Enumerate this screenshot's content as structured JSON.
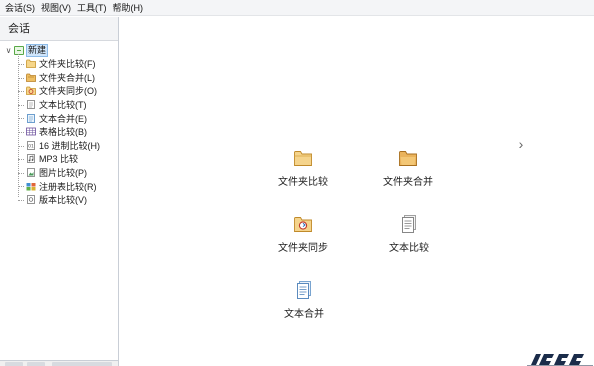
{
  "menubar": {
    "items": [
      "会话(S)",
      "视图(V)",
      "工具(T)",
      "帮助(H)"
    ]
  },
  "sidebar": {
    "header": "会话",
    "root_label": "新建",
    "items": [
      {
        "label": "文件夹比较(F)",
        "icon": "folder-compare-icon"
      },
      {
        "label": "文件夹合并(L)",
        "icon": "folder-merge-icon"
      },
      {
        "label": "文件夹同步(O)",
        "icon": "folder-sync-icon"
      },
      {
        "label": "文本比较(T)",
        "icon": "text-compare-icon"
      },
      {
        "label": "文本合并(E)",
        "icon": "text-merge-icon"
      },
      {
        "label": "表格比较(B)",
        "icon": "table-compare-icon"
      },
      {
        "label": "16 进制比较(H)",
        "icon": "hex-compare-icon"
      },
      {
        "label": "MP3 比较",
        "icon": "mp3-compare-icon"
      },
      {
        "label": "图片比较(P)",
        "icon": "picture-compare-icon"
      },
      {
        "label": "注册表比较(R)",
        "icon": "registry-compare-icon"
      },
      {
        "label": "版本比较(V)",
        "icon": "version-compare-icon"
      }
    ]
  },
  "main": {
    "tiles": [
      {
        "label": "文件夹比较",
        "icon": "folder-compare-icon"
      },
      {
        "label": "文件夹合并",
        "icon": "folder-merge-icon"
      },
      {
        "label": "文件夹同步",
        "icon": "folder-sync-icon"
      },
      {
        "label": "文本比较",
        "icon": "text-compare-icon"
      },
      {
        "label": "文本合并",
        "icon": "text-merge-icon"
      }
    ],
    "next_icon": "chevron-right-icon"
  },
  "colors": {
    "folder": "#e8b85a",
    "selection": "#cfe5fb",
    "accent": "#1e7bd6"
  }
}
